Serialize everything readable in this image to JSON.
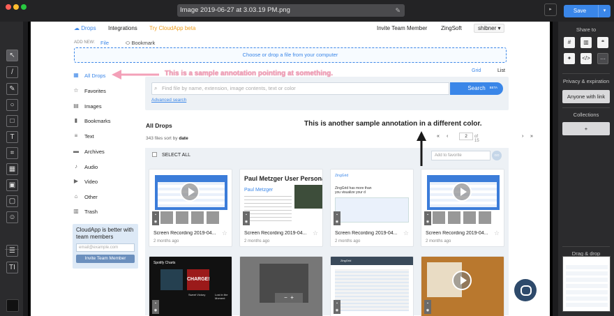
{
  "window": {
    "filename": "Image 2019-06-27 at 3.03.19 PM.png",
    "save_label": "Save",
    "save_dropdown": "▾",
    "more_arrow": "▸"
  },
  "tools": [
    {
      "name": "select-arrow-icon",
      "glyph": "↖"
    },
    {
      "name": "line-icon",
      "glyph": "/"
    },
    {
      "name": "highlighter-icon",
      "glyph": "✎"
    },
    {
      "name": "circle-icon",
      "glyph": "○"
    },
    {
      "name": "rectangle-icon",
      "glyph": "□"
    },
    {
      "name": "text-icon",
      "glyph": "T"
    },
    {
      "name": "crop-icon",
      "glyph": "⌗"
    },
    {
      "name": "blur-icon",
      "glyph": "▦"
    },
    {
      "name": "spotlight-icon",
      "glyph": "▣"
    },
    {
      "name": "frame-icon",
      "glyph": "▢"
    },
    {
      "name": "emoji-icon",
      "glyph": "☺"
    },
    {
      "name": "line-width-icon",
      "glyph": "☰"
    },
    {
      "name": "font-size-icon",
      "glyph": "TI"
    }
  ],
  "right_panel": {
    "share_to": "Share to",
    "privacy": "Privacy & expiration",
    "anyone_with_link": "Anyone with link",
    "collections": "Collections",
    "add_collection": "+",
    "drag_drop": "Drag & drop",
    "more": "⋯",
    "embed": "</>"
  },
  "nav": {
    "logo": "☁ Drops",
    "integrations": "Integrations",
    "try_beta": "Try CloudApp beta",
    "invite": "Invite Team Member",
    "org": "ZingSoft",
    "user": "shibner ▾"
  },
  "add_new": {
    "label": "ADD NEW:",
    "file": "File",
    "bookmark": "⬭ Bookmark"
  },
  "dropzone": "Choose or drop a file from your computer",
  "view": {
    "grid": "Grid",
    "list": "List"
  },
  "sidebar": {
    "items": [
      {
        "label": "All Drops",
        "icon": "▦",
        "active": true
      },
      {
        "label": "Favorites",
        "icon": "☆"
      },
      {
        "label": "Images",
        "icon": "▤"
      },
      {
        "label": "Bookmarks",
        "icon": "▮"
      },
      {
        "label": "Text",
        "icon": "≡"
      },
      {
        "label": "Archives",
        "icon": "▬"
      },
      {
        "label": "Audio",
        "icon": "♪"
      },
      {
        "label": "Video",
        "icon": "▶"
      },
      {
        "label": "Other",
        "icon": "⌂"
      },
      {
        "label": "Trash",
        "icon": "▥"
      }
    ]
  },
  "promo": {
    "title": "CloudApp is better with team members",
    "email_placeholder": "email@example.com",
    "button": "Invite Team Member"
  },
  "search": {
    "placeholder": "Find file by name, extension, image contents, text or color",
    "button": "Search",
    "beta": "BETA",
    "advanced": "Advanced search"
  },
  "drops": {
    "title": "All Drops",
    "count": "343 files sort by",
    "sort": "date",
    "page": "2",
    "of": "of 15",
    "select_all": "SELECT ALL",
    "favorite_placeholder": "Add to favorite",
    "go": "GO"
  },
  "cards": [
    {
      "title": "Screen Recording 2019-04...",
      "age": "2 months ago",
      "kind": "video"
    },
    {
      "title": "Screen Recording 2019-04...",
      "age": "2 months ago",
      "kind": "persona",
      "heading": "Paul Metzger User Persona",
      "name": "Paul Metzger"
    },
    {
      "title": "Screen Recording 2019-04...",
      "age": "2 months ago",
      "kind": "site",
      "brand": "ZingGrid",
      "tagline": "ZingGrid has more than you visualize your d"
    },
    {
      "title": "Screen Recording 2019-04...",
      "age": "2 months ago",
      "kind": "video"
    }
  ],
  "cards_row2": [
    {
      "heading": "Spotify Charts",
      "label1": "CHARGE!",
      "label2": "Sweet Victory",
      "label3": "Lost in the Moment"
    },
    {
      "heading": ""
    },
    {
      "heading": "ZingGrid"
    },
    {
      "heading": ""
    }
  ],
  "annotations": {
    "pink": "This is a sample annotation pointing at something.",
    "dark": "This is another sample annotation in a different color."
  },
  "colors": {
    "accent": "#3a86e8",
    "pink_annotation": "#f3a0b8"
  }
}
